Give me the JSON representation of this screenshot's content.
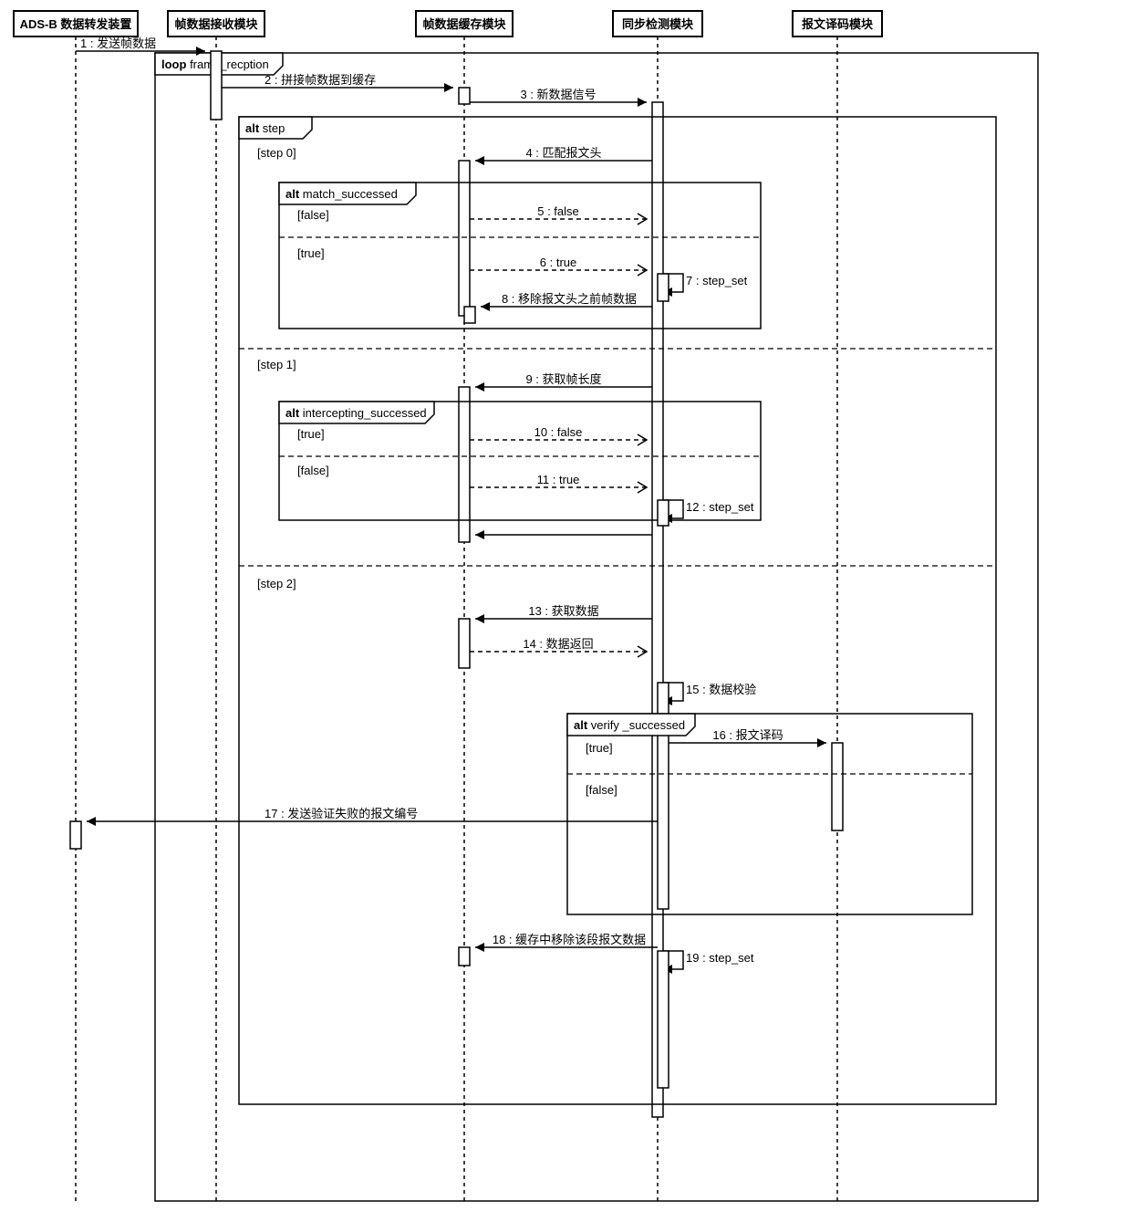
{
  "participants": {
    "p1": "ADS-B 数据转发装置",
    "p2": "帧数据接收模块",
    "p3": "帧数据缓存模块",
    "p4": "同步检测模块",
    "p5": "报文译码模块"
  },
  "frames": {
    "loop": {
      "kw": "loop",
      "name": "frame_recption"
    },
    "altStep": {
      "kw": "alt",
      "name": "step",
      "guards": [
        "[step 0]",
        "[step 1]",
        "[step 2]"
      ]
    },
    "altMatch": {
      "kw": "alt",
      "name": "match_successed",
      "guards": [
        "[false]",
        "[true]"
      ]
    },
    "altIntercept": {
      "kw": "alt",
      "name": "intercepting_successed",
      "guards": [
        "[true]",
        "[false]"
      ]
    },
    "altVerify": {
      "kw": "alt",
      "name": "verify _successed",
      "guards": [
        "[true]",
        "[false]"
      ]
    }
  },
  "messages": {
    "m1": "1 : 发送帧数据",
    "m2": "2 : 拼接帧数据到缓存",
    "m3": "3 : 新数据信号",
    "m4": "4 : 匹配报文头",
    "m5": "5 : false",
    "m6": "6 : true",
    "m7": "7 : step_set",
    "m8": "8 : 移除报文头之前帧数据",
    "m9": "9 : 获取帧长度",
    "m10": "10 : false",
    "m11": "11 : true",
    "m12": "12 : step_set",
    "m13": "13 : 获取数据",
    "m14": "14 : 数据返回",
    "m15": "15 : 数据校验",
    "m16": "16 : 报文译码",
    "m17": "17 : 发送验证失败的报文编号",
    "m18": "18 : 缓存中移除该段报文数据",
    "m19": "19 : step_set"
  },
  "chart_data": {
    "type": "uml-sequence-diagram",
    "participants": [
      "ADS-B 数据转发装置",
      "帧数据接收模块",
      "帧数据缓存模块",
      "同步检测模块",
      "报文译码模块"
    ],
    "interactions": [
      {
        "n": 1,
        "from": "ADS-B 数据转发装置",
        "to": "帧数据接收模块",
        "label": "发送帧数据",
        "type": "sync"
      },
      {
        "n": 2,
        "from": "帧数据接收模块",
        "to": "帧数据缓存模块",
        "label": "拼接帧数据到缓存",
        "type": "sync",
        "frame": "loop frame_recption"
      },
      {
        "n": 3,
        "from": "帧数据缓存模块",
        "to": "同步检测模块",
        "label": "新数据信号",
        "type": "sync"
      },
      {
        "n": 4,
        "from": "同步检测模块",
        "to": "帧数据缓存模块",
        "label": "匹配报文头",
        "type": "sync",
        "frame": "alt step [step 0]"
      },
      {
        "n": 5,
        "from": "帧数据缓存模块",
        "to": "同步检测模块",
        "label": "false",
        "type": "return",
        "frame": "alt match_successed [false]"
      },
      {
        "n": 6,
        "from": "帧数据缓存模块",
        "to": "同步检测模块",
        "label": "true",
        "type": "return",
        "frame": "alt match_successed [true]"
      },
      {
        "n": 7,
        "from": "同步检测模块",
        "to": "同步检测模块",
        "label": "step_set",
        "type": "self"
      },
      {
        "n": 8,
        "from": "同步检测模块",
        "to": "帧数据缓存模块",
        "label": "移除报文头之前帧数据",
        "type": "sync"
      },
      {
        "n": 9,
        "from": "同步检测模块",
        "to": "帧数据缓存模块",
        "label": "获取帧长度",
        "type": "sync",
        "frame": "alt step [step 1]"
      },
      {
        "n": 10,
        "from": "帧数据缓存模块",
        "to": "同步检测模块",
        "label": "false",
        "type": "return",
        "frame": "alt intercepting_successed [true]"
      },
      {
        "n": 11,
        "from": "帧数据缓存模块",
        "to": "同步检测模块",
        "label": "true",
        "type": "return",
        "frame": "alt intercepting_successed [false]"
      },
      {
        "n": 12,
        "from": "同步检测模块",
        "to": "同步检测模块",
        "label": "step_set",
        "type": "self"
      },
      {
        "n": 13,
        "from": "同步检测模块",
        "to": "帧数据缓存模块",
        "label": "获取数据",
        "type": "sync",
        "frame": "alt step [step 2]"
      },
      {
        "n": 14,
        "from": "帧数据缓存模块",
        "to": "同步检测模块",
        "label": "数据返回",
        "type": "return"
      },
      {
        "n": 15,
        "from": "同步检测模块",
        "to": "同步检测模块",
        "label": "数据校验",
        "type": "self"
      },
      {
        "n": 16,
        "from": "同步检测模块",
        "to": "报文译码模块",
        "label": "报文译码",
        "type": "sync",
        "frame": "alt verify_successed [true]"
      },
      {
        "n": 17,
        "from": "同步检测模块",
        "to": "ADS-B 数据转发装置",
        "label": "发送验证失败的报文编号",
        "type": "sync",
        "frame": "alt verify_successed [false]"
      },
      {
        "n": 18,
        "from": "同步检测模块",
        "to": "帧数据缓存模块",
        "label": "缓存中移除该段报文数据",
        "type": "sync"
      },
      {
        "n": 19,
        "from": "同步检测模块",
        "to": "同步检测模块",
        "label": "step_set",
        "type": "self"
      }
    ]
  }
}
